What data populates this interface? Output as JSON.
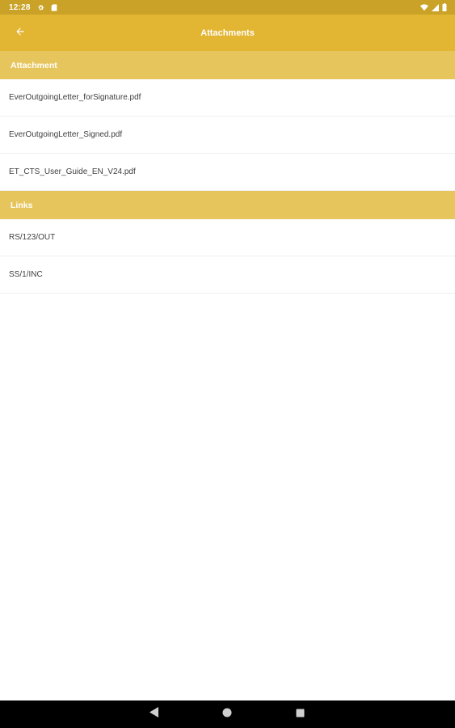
{
  "status_bar": {
    "time": "12:28"
  },
  "app_bar": {
    "title": "Attachments"
  },
  "sections": {
    "attachment": {
      "header": "Attachment",
      "items": [
        "EverOutgoingLetter_forSignature.pdf",
        "EverOutgoingLetter_Signed.pdf",
        "ET_CTS_User_Guide_EN_V24.pdf"
      ]
    },
    "links": {
      "header": "Links",
      "items": [
        "RS/123/OUT",
        "SS/1/INC"
      ]
    }
  },
  "colors": {
    "status_bar": "#c9a227",
    "app_bar": "#e2b532",
    "section_header": "#e7c55d",
    "nav_bar": "#000000"
  },
  "icons": {
    "status": [
      "gear-icon",
      "sd-card-icon",
      "wifi-icon",
      "signal-icon",
      "battery-icon"
    ],
    "app_bar": "arrow-back-icon",
    "nav": [
      "nav-back-icon",
      "nav-home-icon",
      "nav-recents-icon"
    ]
  }
}
